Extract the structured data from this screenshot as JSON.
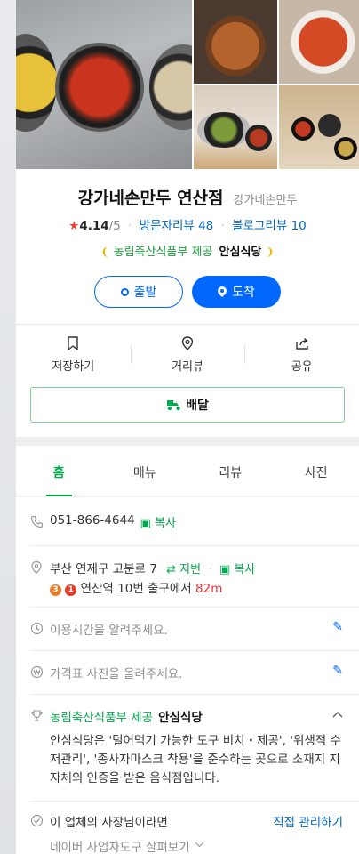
{
  "place": {
    "name": "강가네손만두 연산점",
    "category": "강가네손만두",
    "rating": "4.14",
    "rating_out_of": "/5",
    "visitor_reviews": "방문자리뷰 48",
    "blog_reviews": "블로그리뷰 10",
    "safe_label": "농림축산식품부 제공",
    "safe_brand": "안심식당"
  },
  "route": {
    "depart": "출발",
    "arrive": "도착"
  },
  "actions": {
    "save": "저장하기",
    "street_view": "거리뷰",
    "share": "공유",
    "delivery": "배달"
  },
  "tabs": [
    "홈",
    "메뉴",
    "리뷰",
    "사진"
  ],
  "info": {
    "phone": "051-866-4644",
    "copy": "복사",
    "address": "부산 연제구 고분로 7",
    "jibun": "지번",
    "station_line1": "3",
    "station_line2": "1",
    "directions": "연산역 10번 출구에서",
    "distance": "82m",
    "hours_prompt": "이용시간을 알려주세요.",
    "price_prompt": "가격표 사진을 올려주세요.",
    "safe_label": "농림축산식품부 제공",
    "safe_brand": "안심식당",
    "safe_desc": "안심식당은 '덜어먹기 가능한 도구 비치・제공', '위생적 수저관리', '종사자마스크 착용'을 준수하는 곳으로 소재지 지자체의 인증을 받은 음식점입니다.",
    "owner_text": "이 업체의 사장님이라면",
    "owner_link": "직접 관리하기",
    "owner_tool": "네이버 사업자도구 살펴보기"
  },
  "colors": {
    "naver_green": "#03a94d",
    "route_blue": "#0068ff",
    "star_red": "#f04338"
  }
}
